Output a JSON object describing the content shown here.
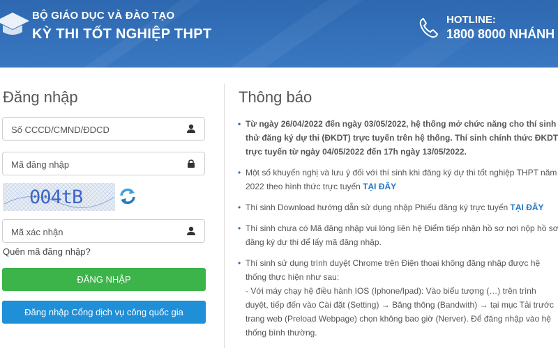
{
  "header": {
    "ministry": "BỘ GIÁO DỤC VÀ ĐÀO TẠO",
    "title": "KỲ THI TỐT NGHIỆP THPT",
    "hotline_label": "HOTLINE:",
    "hotline_number": "1800 8000 NHÁNH",
    "colors": {
      "background": "#2f6cb5",
      "text": "#ffffff"
    }
  },
  "login": {
    "title": "Đăng nhập",
    "id_placeholder": "Số CCCD/CMND/ĐDCD",
    "code_placeholder": "Mã đăng nhập",
    "captcha_text": "004tB",
    "verify_placeholder": "Mã xác nhận",
    "forgot_link": "Quên mã đăng nhập?",
    "login_button": "ĐĂNG NHẬP",
    "gov_button": "Đăng nhập Cổng dịch vụ công quốc gia",
    "colors": {
      "login_button": "#3cb44a",
      "gov_button": "#1f8fd8"
    }
  },
  "notice": {
    "title": "Thông báo",
    "items": [
      {
        "text": "Từ ngày 26/04/2022 đến ngày 03/05/2022, hệ thống mở chức năng cho thí sinh thử đăng ký dự thi (ĐKDT) trực tuyến trên hệ thống. Thí sinh chính thức ĐKDT trực tuyến từ ngày 04/05/2022 đến 17h ngày 13/05/2022."
      },
      {
        "text": "Một số khuyến nghị và lưu ý đối với thí sinh khi đăng ký dự thi tốt nghiệp THPT năm 2022 theo hình thức trực tuyến ",
        "link": "TẠI ĐÂY"
      },
      {
        "text": "Thí sinh Download hướng dẫn sử dụng nhập Phiếu đăng ký trực tuyến ",
        "link": "TẠI ĐÂY"
      },
      {
        "text": "Thí sinh chưa có Mã đăng nhập vui lòng liên hệ Điểm tiếp nhận hồ sơ nơi nộp hồ sơ đăng ký dự thi để lấy mã đăng nhập."
      },
      {
        "text": "Thí sinh sử dụng trình duyệt Chrome trên Điện thoại không đăng nhập được hệ thống thực hiện như sau:",
        "sub": " - Với máy chạy hệ điều hành IOS (Iphone/Ipad): Vào biểu tượng (…) trên trình duyệt, tiếp đến vào Cài đặt (Setting) → Băng thông (Bandwith) → tại mục Tải trước trang web (Preload Webpage) chọn không bao giờ (Nerver). Để đăng nhập vào hệ thống bình thường."
      }
    ],
    "link_color": "#1e77c8"
  }
}
